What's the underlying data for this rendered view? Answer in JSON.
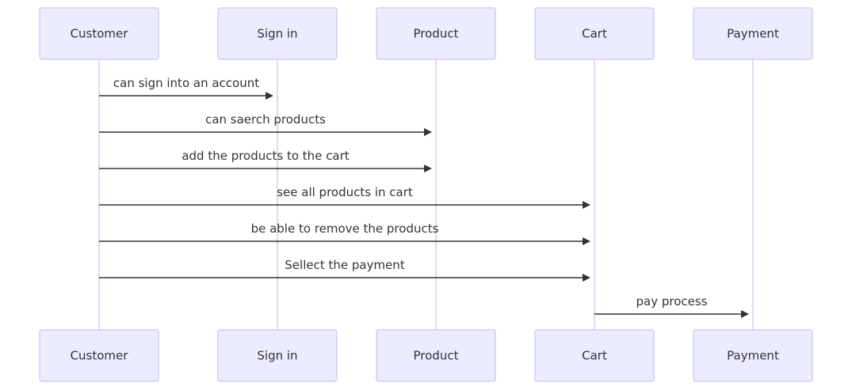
{
  "diagram": {
    "type": "sequence",
    "participants": [
      {
        "id": "customer",
        "label": "Customer"
      },
      {
        "id": "signin",
        "label": "Sign in"
      },
      {
        "id": "product",
        "label": "Product"
      },
      {
        "id": "cart",
        "label": "Cart"
      },
      {
        "id": "payment",
        "label": "Payment"
      }
    ],
    "messages": [
      {
        "from": "customer",
        "to": "signin",
        "label": "can sign into an account"
      },
      {
        "from": "customer",
        "to": "product",
        "label": "can saerch products"
      },
      {
        "from": "customer",
        "to": "product",
        "label": "add the products to the cart"
      },
      {
        "from": "customer",
        "to": "cart",
        "label": "see all products in cart"
      },
      {
        "from": "customer",
        "to": "cart",
        "label": "be able to remove the products"
      },
      {
        "from": "customer",
        "to": "cart",
        "label": "Sellect the payment"
      },
      {
        "from": "cart",
        "to": "payment",
        "label": "pay process"
      }
    ]
  }
}
